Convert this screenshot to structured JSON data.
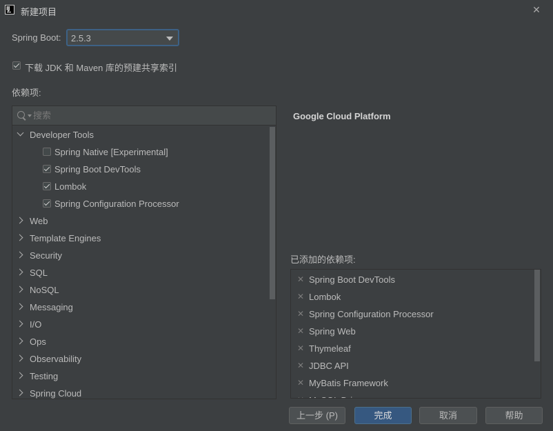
{
  "window": {
    "title": "新建项目",
    "close_label": "✕"
  },
  "spring_boot": {
    "label": "Spring Boot:",
    "selected": "2.5.3"
  },
  "download_option": {
    "label": "下载 JDK 和 Maven 库的预建共享索引",
    "checked": true
  },
  "dependencies_label": "依赖项:",
  "search": {
    "placeholder": "搜索"
  },
  "tree": {
    "expanded_group": "Developer Tools",
    "children": [
      {
        "label": "Spring Native [Experimental]",
        "checked": false
      },
      {
        "label": "Spring Boot DevTools",
        "checked": true
      },
      {
        "label": "Lombok",
        "checked": true
      },
      {
        "label": "Spring Configuration Processor",
        "checked": true
      }
    ],
    "groups": [
      "Web",
      "Template Engines",
      "Security",
      "SQL",
      "NoSQL",
      "Messaging",
      "I/O",
      "Ops",
      "Observability",
      "Testing",
      "Spring Cloud"
    ]
  },
  "detail": {
    "title": "Google Cloud Platform"
  },
  "added": {
    "label": "已添加的依赖项:",
    "items": [
      "Spring Boot DevTools",
      "Lombok",
      "Spring Configuration Processor",
      "Spring Web",
      "Thymeleaf",
      "JDBC API",
      "MyBatis Framework",
      "MySQL Driver"
    ]
  },
  "buttons": {
    "prev": "上一步 (P)",
    "finish": "完成",
    "cancel": "取消",
    "help": "帮助"
  },
  "colors": {
    "background": "#3c3f41",
    "accent": "#365880",
    "focus_border": "#3d6185"
  }
}
